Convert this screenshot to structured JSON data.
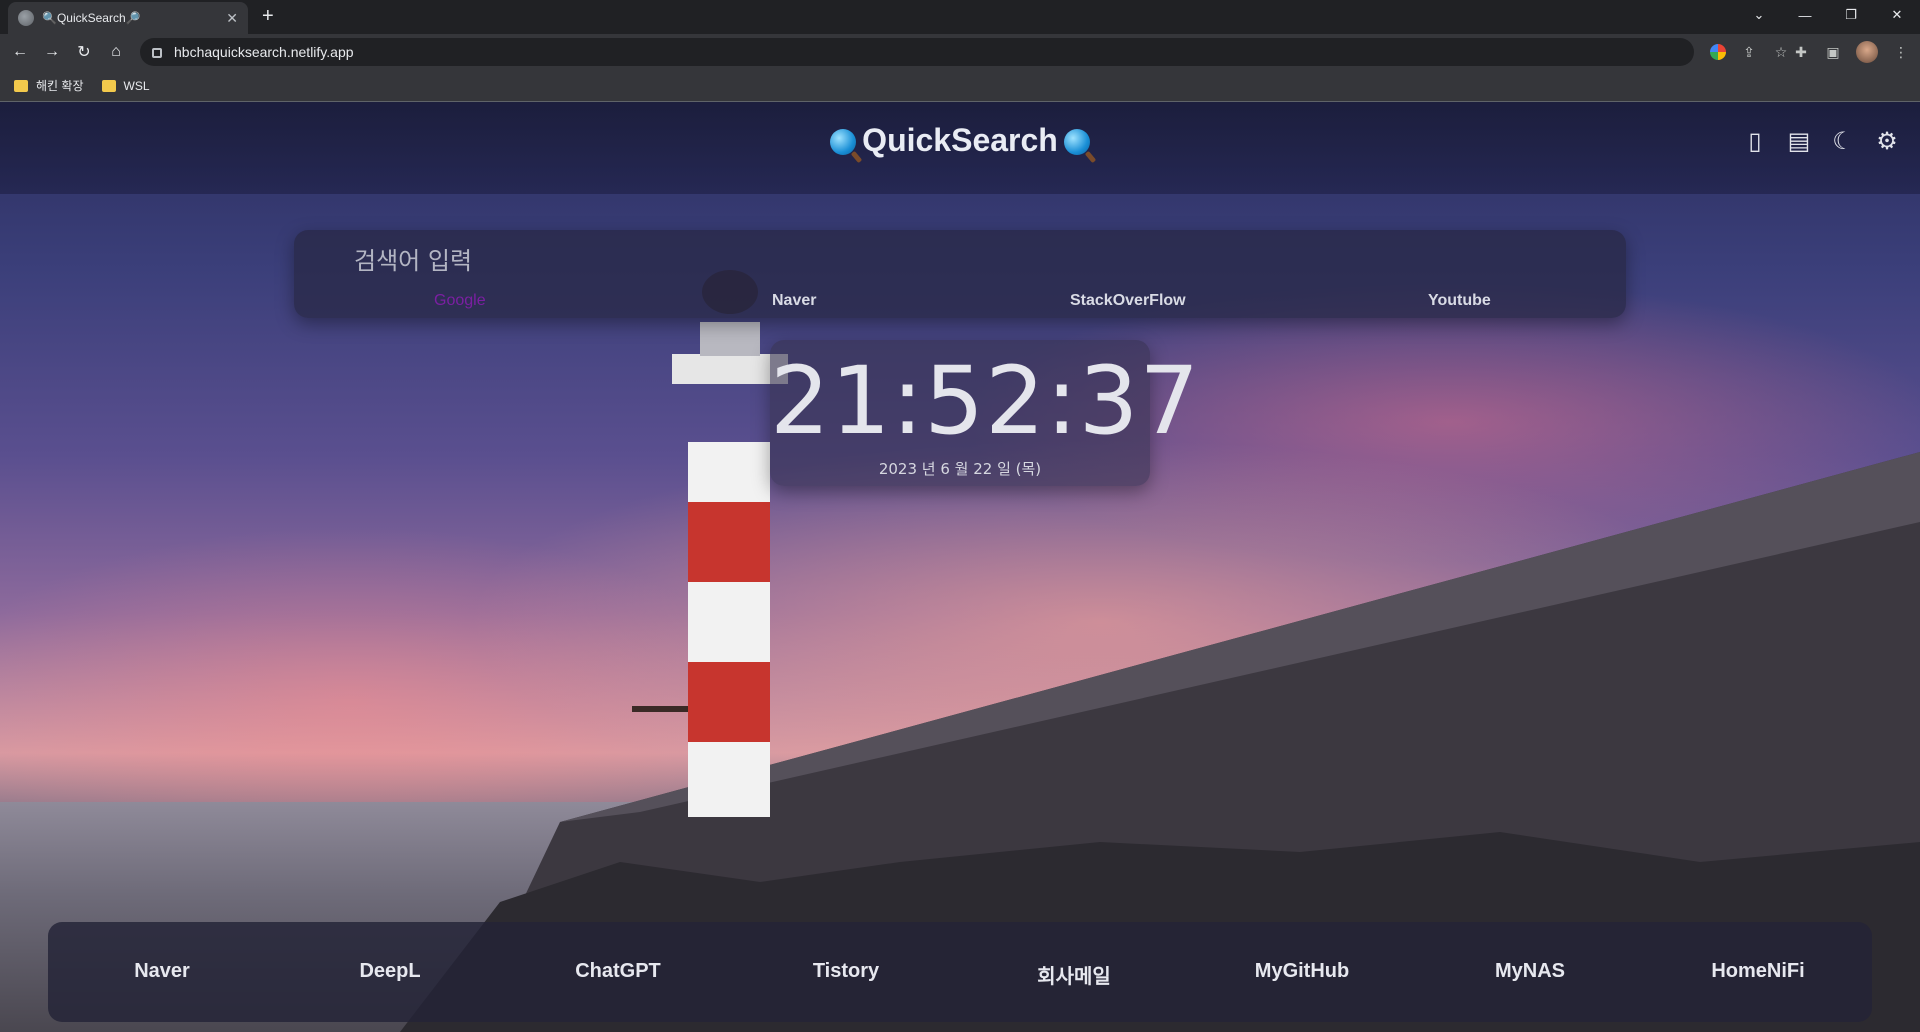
{
  "browser": {
    "tab_title": "🔍QuickSearch🔎",
    "url": "hbchaquicksearch.netlify.app",
    "bookmarks": [
      "해킨 확장",
      "WSL"
    ]
  },
  "header": {
    "title": "QuickSearch",
    "icons": [
      "notepad-icon",
      "table-icon",
      "moon-icon",
      "gear-icon"
    ]
  },
  "search": {
    "placeholder": "검색어 입력",
    "engines": [
      "Google",
      "Naver",
      "StackOverFlow",
      "Youtube"
    ],
    "active_engine": "Google"
  },
  "clock": {
    "time": "21:52:37",
    "date": "2023 년 6 월 22 일 (목)"
  },
  "quick_links": [
    "Naver",
    "DeepL",
    "ChatGPT",
    "Tistory",
    "회사메일",
    "MyGitHub",
    "MyNAS",
    "HomeNiFi"
  ],
  "colors": {
    "active_engine": "#7b1fa2",
    "header_bg": "#1e2046"
  }
}
